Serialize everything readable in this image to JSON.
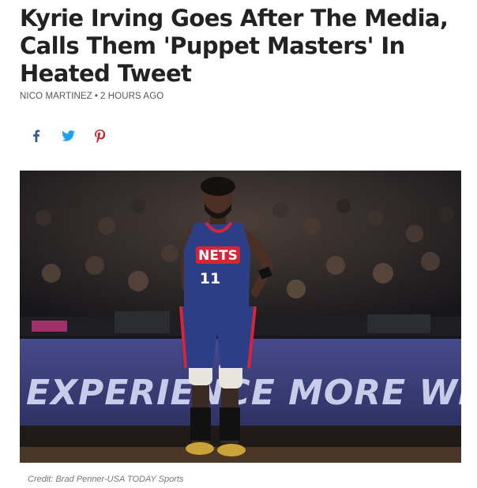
{
  "article": {
    "headline": "Kyrie Irving Goes After The Media, Calls Them 'Puppet Masters' In Heated Tweet",
    "author": "NICO MARTINEZ",
    "separator": "•",
    "time": "2 HOURS AGO"
  },
  "share": [
    {
      "icon": "facebook-icon",
      "color": "#3b5998"
    },
    {
      "icon": "twitter-icon",
      "color": "#1da1f2"
    },
    {
      "icon": "pinterest-icon",
      "color": "#cb2027"
    }
  ],
  "photo": {
    "jersey_team": "NETS",
    "jersey_number": "11",
    "banner_text": "EXPERIENCE MORE WHEN YO",
    "colors": {
      "jersey": "#2c3f86",
      "banner": "#3a3d78",
      "trim": "#d3263a"
    }
  },
  "caption": {
    "credit": "Credit: Brad Penner-USA TODAY Sports"
  }
}
